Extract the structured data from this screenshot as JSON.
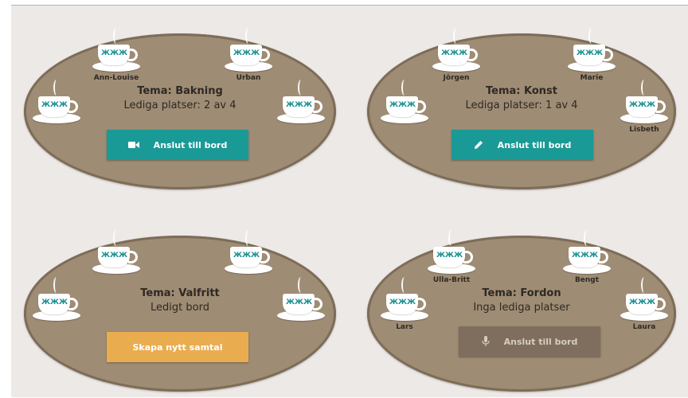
{
  "tables": [
    {
      "theme": "Tema: Bakning",
      "seats_text": "Lediga platser: 2 av 4",
      "button_label": "Anslut till bord",
      "button_icon": "video-camera-icon",
      "seats": [
        "Ann-Louise",
        "Urban",
        "",
        ""
      ]
    },
    {
      "theme": "Tema: Konst",
      "seats_text": "Lediga platser: 1 av 4",
      "button_label": "Anslut till bord",
      "button_icon": "pencil-icon",
      "seats": [
        "Jörgen",
        "Marie",
        "",
        "Lisbeth"
      ]
    },
    {
      "theme": "Tema: Valfritt",
      "seats_text": "Ledigt bord",
      "button_label": "Skapa nytt samtal",
      "button_icon": "",
      "seats": [
        "",
        "",
        "",
        ""
      ]
    },
    {
      "theme": "Tema: Fordon",
      "seats_text": "Inga lediga platser",
      "button_label": "Anslut till bord",
      "button_icon": "microphone-icon",
      "seats": [
        "Ulla-Britt",
        "Bengt",
        "Lars",
        "Laura"
      ]
    }
  ],
  "colors": {
    "table": "#9f8c74",
    "teal_button": "#1a9a96",
    "orange_button": "#e9ad4f",
    "disabled_button": "#7f6e5d",
    "background": "#ece9e6"
  }
}
